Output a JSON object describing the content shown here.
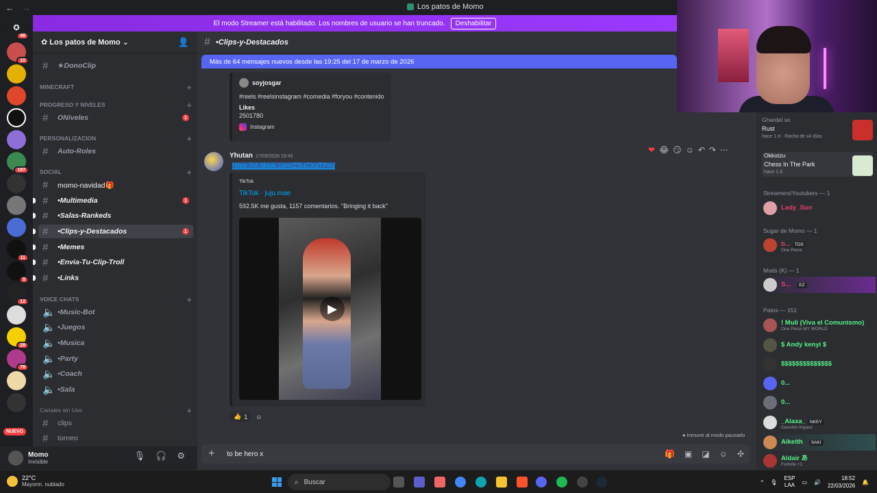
{
  "window": {
    "title": "Los patos de Momo"
  },
  "banner": {
    "text": "El modo Streamer está habilitado. Los nombres de usuario se han truncado.",
    "button": "Deshabilitar"
  },
  "guilds": {
    "badges": [
      "48",
      "10",
      "197",
      "11",
      "5",
      "12",
      "29",
      "78"
    ],
    "nuevo": "NUEVO"
  },
  "server": {
    "name": "Los patos de Momo"
  },
  "channels": [
    {
      "label": "★DonoClip"
    },
    {
      "label": "MINECRAFT"
    },
    {
      "label": "PROGRESO Y NIVELES"
    },
    {
      "label": "ONiveles",
      "unread": "1"
    },
    {
      "label": "PERSONALIZACION"
    },
    {
      "label": "Auto-Roles"
    },
    {
      "label": "SOCIAL"
    },
    {
      "label": "momo-navidad🎁"
    },
    {
      "label": "•Multimedia",
      "unread": "1"
    },
    {
      "label": "•Salas-Rankeds"
    },
    {
      "label": "•Clips-y-Destacados",
      "unread": "1"
    },
    {
      "label": "•Memes"
    },
    {
      "label": "•Envia-Tu-Clip-Troll"
    },
    {
      "label": "•Links"
    },
    {
      "label": "VOICE CHATS"
    },
    {
      "label": "•Music-Bot"
    },
    {
      "label": "•Juegos"
    },
    {
      "label": "•Musica"
    },
    {
      "label": "•Party"
    },
    {
      "label": "•Coach"
    },
    {
      "label": "•Sala"
    },
    {
      "label": "Canales sin Uso"
    },
    {
      "label": "clips"
    },
    {
      "label": "torneo"
    }
  ],
  "user": {
    "name": "Momo",
    "status": "Invisible"
  },
  "header": {
    "channel": "•Clips-y-Destacados"
  },
  "newbar": {
    "text": "Más de 64 mensajes nuevos desde las 19:25 del 17 de marzo de 2026"
  },
  "embed1": {
    "author": "soyjosgar",
    "desc": "#reels #reelsinstagram #comedia #foryou #contenido",
    "field_name": "Likes",
    "field_value": "2501780",
    "footer": "Instagram"
  },
  "message": {
    "author": "Yhutan",
    "time": "17/03/2026 19:45",
    "link": "https://vt.tiktok.com/ZSuCXdTPm/"
  },
  "embed2": {
    "provider": "TikTok",
    "title": "TikTok · juju.mae",
    "desc": "592.5K me gusta, 1157 comentarios. \"Bringing it back\""
  },
  "reactions": {
    "count": "1"
  },
  "status": {
    "paused": "Inmune al modo pausado"
  },
  "composer": {
    "text": "to be hero x"
  },
  "activities": [
    {
      "user": "Ghardel so",
      "game": "Rust",
      "sub": "hace 1 d",
      "extra": "Racha de x4 días"
    },
    {
      "user": "Okkotzu",
      "game": "Chess In The Park",
      "sub": "hace 1 d"
    }
  ],
  "members": {
    "cat1": "Streamers/Youtubers — 1",
    "cat2": "Sugar de Momo — 1",
    "cat3": "Mods (K) — 1",
    "cat4": "Patos — 151",
    "list": [
      {
        "name": "Lady_Sun",
        "sub": ""
      },
      {
        "name": "b...",
        "tag": "TDS",
        "sub": "One Piece"
      },
      {
        "name": "S...",
        "tag": "EZ",
        "sub": ""
      },
      {
        "name": "! Muli (Viva el Comunismo)",
        "sub": "One Piece MY WORLD"
      },
      {
        "name": "$ Andy kenyi $",
        "sub": ""
      },
      {
        "name": "$$$$$$$$$$$$$$",
        "sub": ""
      },
      {
        "name": "0...",
        "sub": ""
      },
      {
        "name": "0...",
        "sub": ""
      },
      {
        "name": "_Alaxa_",
        "tag": "NKEY",
        "sub": "Genshin Impact"
      },
      {
        "name": "Aikeith",
        "tag": "SAKI",
        "sub": ""
      },
      {
        "name": "Aldair あ",
        "sub": "Fortnite +1"
      }
    ]
  },
  "taskbar": {
    "temp": "22°C",
    "weather": "Mayorm. nublado",
    "search": "Buscar",
    "lang1": "ESP",
    "lang2": "LAA",
    "time": "18:52",
    "date": "22/03/2026"
  },
  "colors": {
    "blurple": "#5865f2",
    "banner": "#9b39ff",
    "bg": "#313338",
    "sidebar": "#2b2d31"
  }
}
